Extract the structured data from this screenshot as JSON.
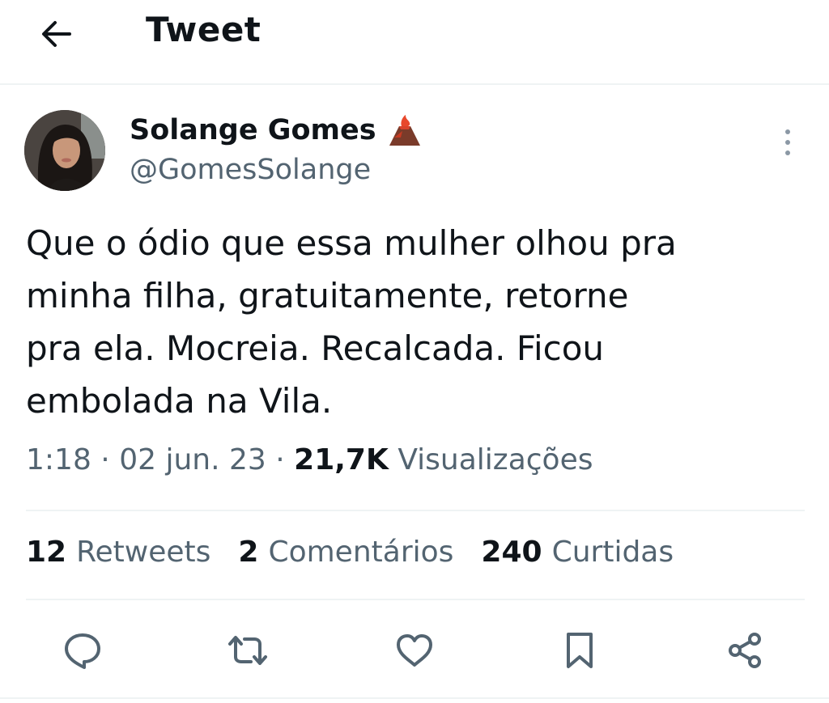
{
  "header": {
    "title": "Tweet",
    "back_icon": "arrow-left-icon"
  },
  "tweet": {
    "author_name": "Solange Gomes",
    "author_emoji": "volcano-emoji",
    "author_handle": "@GomesSolange",
    "text_lines": [
      "Que o ódio que essa mulher olhou pra",
      "minha filha, gratuitamente, retorne",
      "pra ela. Mocreia. Recalcada. Ficou",
      "embolada na Vila."
    ],
    "time": "1:18",
    "date": "02 jun. 23",
    "views_count": "21,7K",
    "views_label": "Visualizações",
    "separator": "·"
  },
  "stats": {
    "retweets_count": "12",
    "retweets_label": "Retweets",
    "comments_count": "2",
    "comments_label": "Comentários",
    "likes_count": "240",
    "likes_label": "Curtidas"
  },
  "actions": [
    "reply-icon",
    "retweet-icon",
    "like-icon",
    "bookmark-icon",
    "share-icon"
  ],
  "colors": {
    "text": "#0f1419",
    "secondary": "#536471",
    "divider": "#eff3f4"
  }
}
